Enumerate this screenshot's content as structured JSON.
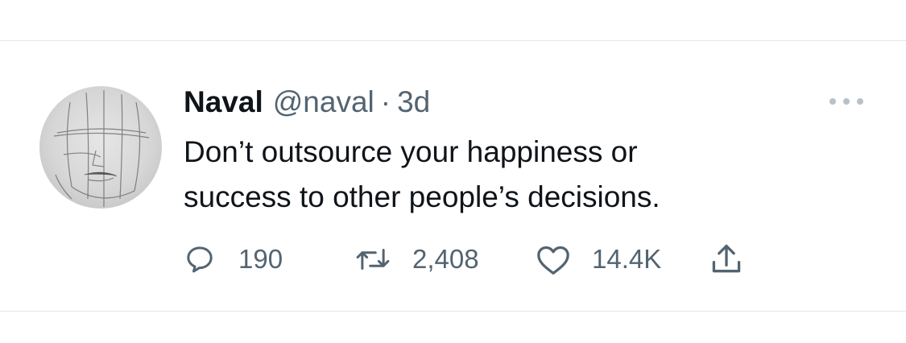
{
  "tweet": {
    "author_name": "Naval",
    "author_handle": "@naval",
    "separator": "·",
    "time": "3d",
    "text": "Don’t outsource your happiness or\nsuccess to other people’s decisions.",
    "reply_count": "190",
    "retweet_count": "2,408",
    "like_count": "14.4K"
  },
  "icons": {
    "avatar": "profile-sketch-avatar",
    "more": "more-options-icon",
    "reply": "reply-icon",
    "retweet": "retweet-icon",
    "like": "heart-icon",
    "share": "share-icon"
  },
  "colors": {
    "text_primary": "#0f1419",
    "text_secondary": "#536471",
    "divider": "#e6e6e6"
  }
}
